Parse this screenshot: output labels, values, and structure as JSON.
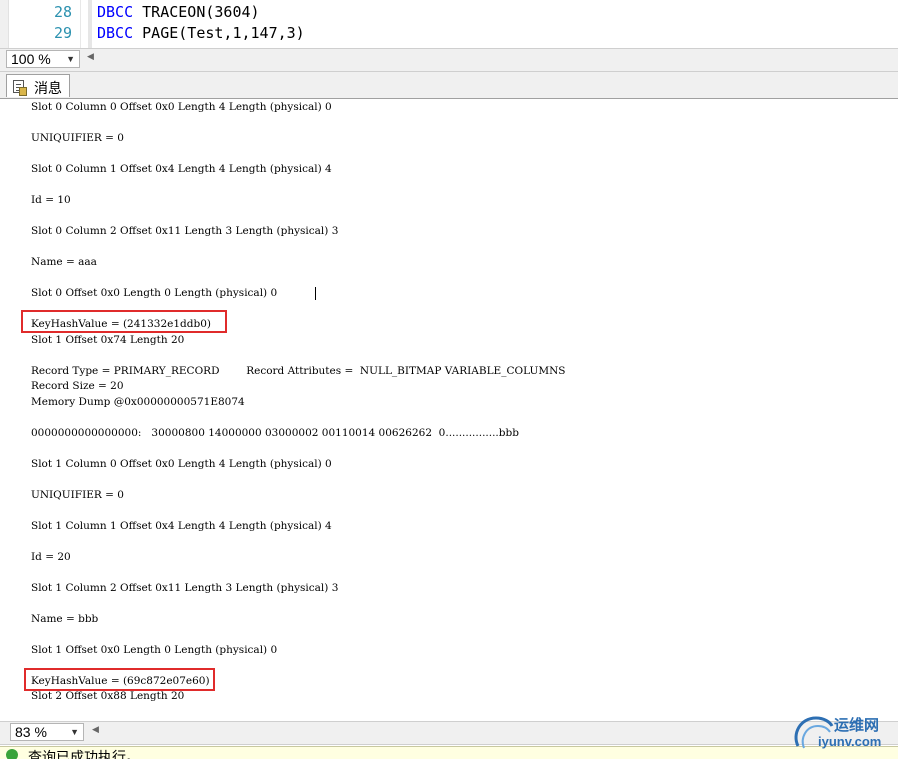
{
  "editor": {
    "lines": [
      {
        "number": "28",
        "keyword": "DBCC",
        "rest": "TRACEON(3604)"
      },
      {
        "number": "29",
        "keyword": "DBCC",
        "rest": "PAGE(Test,1,147,3)"
      }
    ]
  },
  "top_zoom": {
    "value": "100 %"
  },
  "results_tab": {
    "label": "消息"
  },
  "messages": [
    "Slot 0 Column 0 Offset 0x0 Length 4 Length (physical) 0",
    "UNIQUIFIER = 0",
    "Slot 0 Column 1 Offset 0x4 Length 4 Length (physical) 4",
    "Id = 10",
    "Slot 0 Column 2 Offset 0x11 Length 3 Length (physical) 3",
    "Name = aaa",
    "Slot 0 Offset 0x0 Length 0 Length (physical) 0",
    "KeyHashValue = (241332e1ddb0)",
    "Slot 1 Offset 0x74 Length 20",
    "Record Type = PRIMARY_RECORD        Record Attributes =  NULL_BITMAP VARIABLE_COLUMNS",
    "Record Size = 20",
    "Memory Dump @0x00000000571E8074",
    "0000000000000000:   30000800 14000000 03000002 00110014 00626262  0................bbb",
    "Slot 1 Column 0 Offset 0x0 Length 4 Length (physical) 0",
    "UNIQUIFIER = 0",
    "Slot 1 Column 1 Offset 0x4 Length 4 Length (physical) 4",
    "Id = 20",
    "Slot 1 Column 2 Offset 0x11 Length 3 Length (physical) 3",
    "Name = bbb",
    "Slot 1 Offset 0x0 Length 0 Length (physical) 0",
    "KeyHashValue = (69c872e07e60)",
    "Slot 2 Offset 0x88 Length 20"
  ],
  "bottom_zoom": {
    "value": "83 %"
  },
  "status": {
    "text": "查询已成功执行。"
  },
  "watermark": {
    "line1": "运维网",
    "line2": "iyunv.com"
  },
  "colors": {
    "highlight": "#e02b2b",
    "line_number": "#2b91af",
    "keyword": "#0000ff"
  }
}
